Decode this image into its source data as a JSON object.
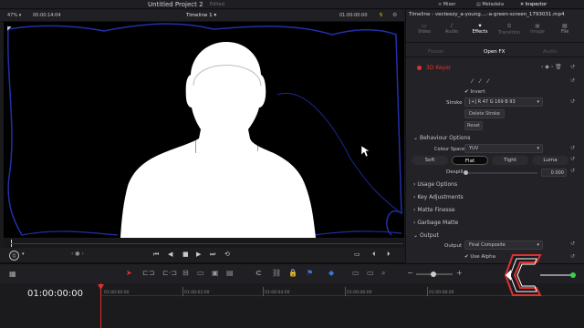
{
  "topbar": {
    "project_title": "Untitled Project 2",
    "edited": "Edited",
    "mixer": "Mixer",
    "metadata": "Metadata",
    "inspector": "Inspector"
  },
  "viewer_bar": {
    "zoom": "47%",
    "timecode_left": "00:00:14:04",
    "timeline_name": "Timeline 1",
    "timecode_right": "01:00:00:00"
  },
  "inspector": {
    "clip_title": "Timeline - vecteezy_a-young....-a-green-screen_1793031.mp4",
    "tabs": [
      "Video",
      "Audio",
      "Effects",
      "Transition",
      "Image",
      "File"
    ],
    "subtabs": [
      "Fusion",
      "Open FX",
      "Audio"
    ],
    "effect_name": "3D Keyer",
    "invert_label": "Invert",
    "stroke_label": "Stroke",
    "stroke_value": "[+]  R 47  G 169  B 93",
    "delete_stroke": "Delete Stroke",
    "reset": "Reset",
    "behaviour_options": "Behaviour Options",
    "color_space_label": "Colour Space",
    "color_space_value": "YUV",
    "modes": [
      "Soft",
      "Flat",
      "Tight",
      "Luma"
    ],
    "active_mode": "Flat",
    "despill_label": "Despill",
    "despill_value": "0.000",
    "sections": [
      "Usage Options",
      "Key Adjustments",
      "Matte Finesse",
      "Garbage Matte",
      "Output"
    ],
    "output_label": "Output",
    "output_value": "Final Composite",
    "use_alpha": "Use Alpha"
  },
  "timeline": {
    "timecode": "01:00:00:00",
    "ruler": [
      "01:00:00:00",
      "01:00:02:00",
      "01:00:04:00",
      "01:00:06:00",
      "01:00:08:00"
    ]
  },
  "colors": {
    "accent_red": "#e0312e",
    "active_tab": "#ffffff",
    "blue_curve": "#2230a8"
  }
}
